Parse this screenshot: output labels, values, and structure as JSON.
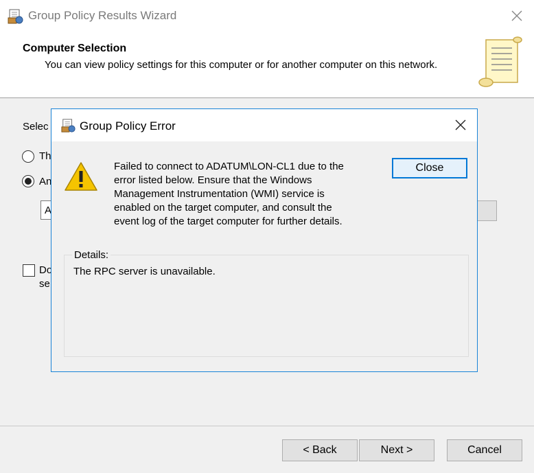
{
  "wizard": {
    "title": "Group Policy Results Wizard",
    "heading": "Computer Selection",
    "subheading": "You can view policy settings for this computer or for another computer on this network.",
    "select_label_visible": "Selec",
    "radio_this_visible": "Th",
    "radio_another_visible": "An",
    "computer_input_visible": "A",
    "checkbox_line1_visible": "Do",
    "checkbox_line2_visible": "se",
    "back_label": "< Back",
    "next_label": "Next >",
    "cancel_label": "Cancel"
  },
  "dialog": {
    "title": "Group Policy Error",
    "message": "Failed to connect to ADATUM\\LON-CL1 due to the\nerror listed below. Ensure that the Windows\nManagement Instrumentation (WMI) service is\nenabled on the target computer, and consult the\nevent log of the target computer for further details.",
    "close_label": "Close",
    "details_label": "Details:",
    "details_text": "The RPC server is unavailable."
  },
  "icons": {
    "app": "group-policy-icon",
    "scroll": "scroll-icon",
    "warning": "warning-icon",
    "close": "close-icon"
  },
  "colors": {
    "accent": "#0078d7",
    "dialog_border": "#1883d7",
    "warning": "#f5c400"
  }
}
